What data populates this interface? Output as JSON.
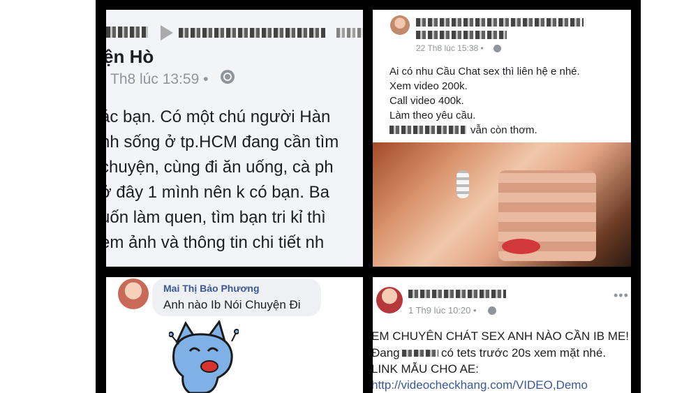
{
  "panel1": {
    "name": "ện Hò",
    "time": "Th8 lúc 13:59 •",
    "lines": [
      "ác bạn. Có một chú người Hàn",
      "nh sống ở tp.HCM đang cần tìm",
      "chuyện, cùng đi ăn uống, cà ph",
      " ở đây 1 mình nên k có bạn. Ba",
      "uốn làm quen, tìm bạn tri kỉ thì",
      "em ảnh và thông tin chi tiết nh"
    ]
  },
  "panel2": {
    "meta": "22 Th8 lúc 15:38 •",
    "lines": [
      "Ai có nhu Cầu Chat sex thì liên hệ e nhé.",
      "Xem video 200k.",
      "Call video 400k.",
      "Làm theo yêu cầu.",
      "vẫn còn thơm."
    ]
  },
  "panel3": {
    "username": "Mai Thị Bảo Phương",
    "message": "Anh nào Ib Nói Chuyện Đi"
  },
  "panel4": {
    "meta": "1 Th9 lúc 10:20 •",
    "menu": "•••",
    "lines": [
      "EM CHUYÊN CHÁT SEX ANH NÀO CẦN IB ME!",
      "có tets trước 20s xem mặt nhé.",
      "LINK MẪU CHO AE:",
      "http://videocheckhang.com/VIDEO,Demo"
    ],
    "line2_prefix": "Đang"
  },
  "icons": {
    "globe": "globe-icon",
    "more": "more-options-icon",
    "share": "share-arrow-icon"
  },
  "colors": {
    "link": "#385898",
    "meta": "#90949c",
    "text": "#1c1e21"
  }
}
